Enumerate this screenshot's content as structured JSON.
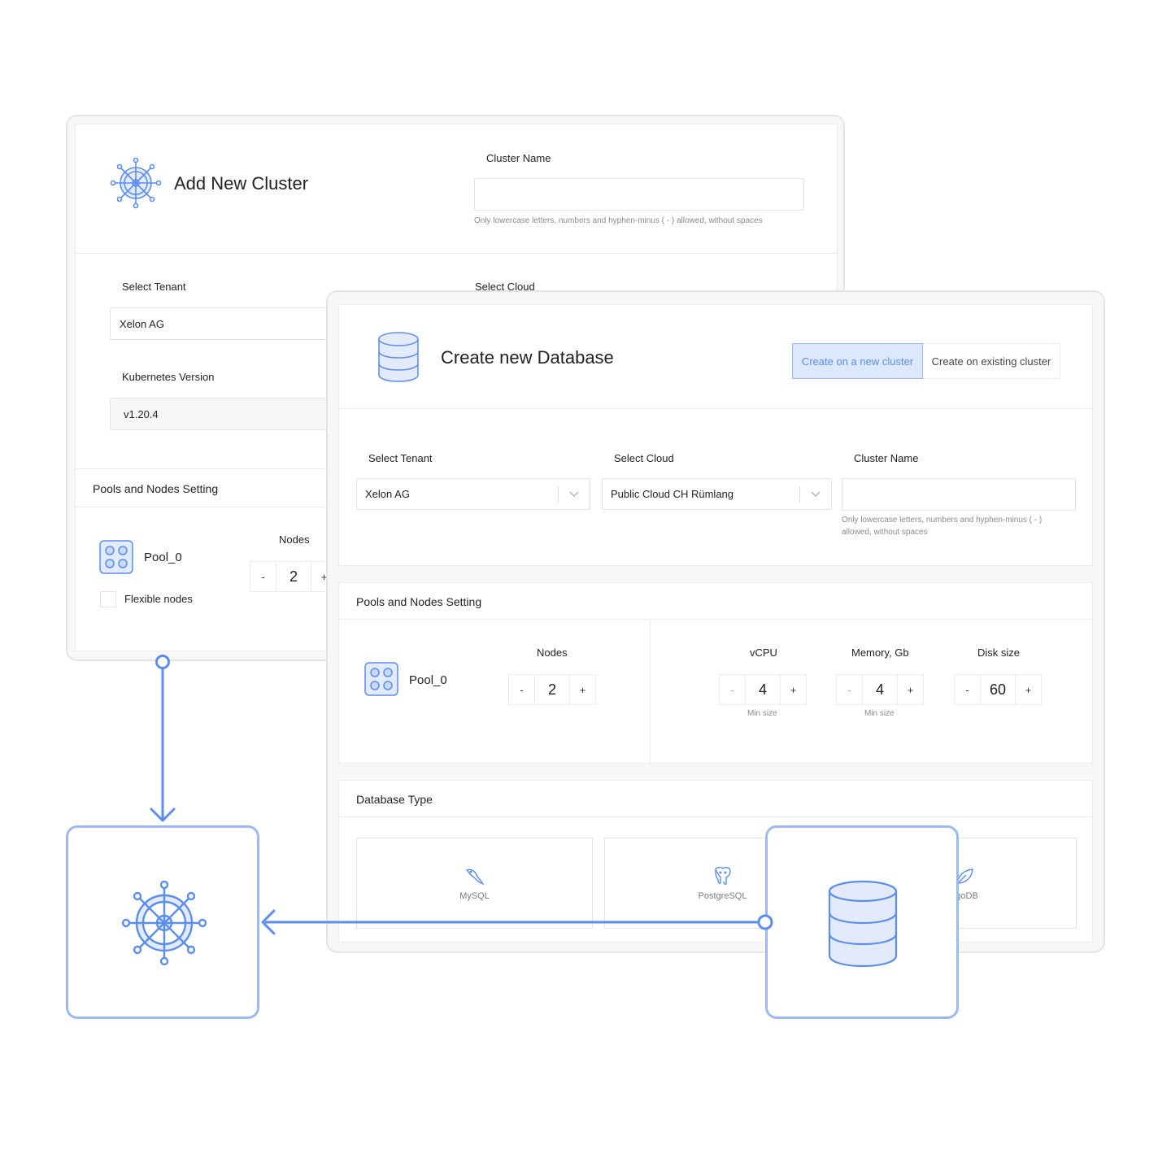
{
  "add_cluster": {
    "title": "Add New Cluster",
    "cluster_name_label": "Cluster Name",
    "cluster_name_value": "",
    "cluster_name_hint": "Only lowercase letters, numbers and hyphen-minus ( - ) allowed, without spaces",
    "tenant_label": "Select Tenant",
    "tenant_value": "Xelon AG",
    "cloud_label": "Select Cloud",
    "k8s_label": "Kubernetes Version",
    "k8s_value": "v1.20.4",
    "pools_title": "Pools and Nodes Setting",
    "pool_name": "Pool_0",
    "nodes_label": "Nodes",
    "nodes_value": "2",
    "minus": "-",
    "plus": "+",
    "flexible_label": "Flexible nodes",
    "flexible_checked": false
  },
  "create_db": {
    "title": "Create new Database",
    "toggle": {
      "new_cluster": "Create on a new cluster",
      "existing_cluster": "Create on existing cluster",
      "selected": "new_cluster"
    },
    "tenant_label": "Select Tenant",
    "tenant_value": "Xelon AG",
    "cloud_label": "Select Cloud",
    "cloud_value": "Public Cloud CH Rümlang",
    "cluster_name_label": "Cluster Name",
    "cluster_name_value": "",
    "cluster_name_hint": "Only lowercase letters, numbers and hyphen-minus ( - ) allowed, without spaces",
    "pools_title": "Pools and Nodes Setting",
    "pool_name": "Pool_0",
    "nodes_label": "Nodes",
    "nodes_value": "2",
    "vcpu_label": "vCPU",
    "vcpu_value": "4",
    "vcpu_hint": "Min size",
    "memory_label": "Memory, Gb",
    "memory_value": "4",
    "memory_hint": "Min size",
    "disk_label": "Disk size",
    "disk_value": "60",
    "minus": "-",
    "plus": "+",
    "db_type_title": "Database Type",
    "db_types": [
      {
        "label": "MySQL",
        "icon": "mysql-dolphin-icon"
      },
      {
        "label": "PostgreSQL",
        "icon": "postgresql-elephant-icon"
      },
      {
        "label": "ngoDB",
        "icon": "mongodb-leaf-icon"
      }
    ]
  },
  "colors": {
    "accent": "#5b8def",
    "accent_light": "#9bb9f0",
    "toggle_bg": "#dde8fc",
    "icon_fill": "#e3ebfa"
  }
}
